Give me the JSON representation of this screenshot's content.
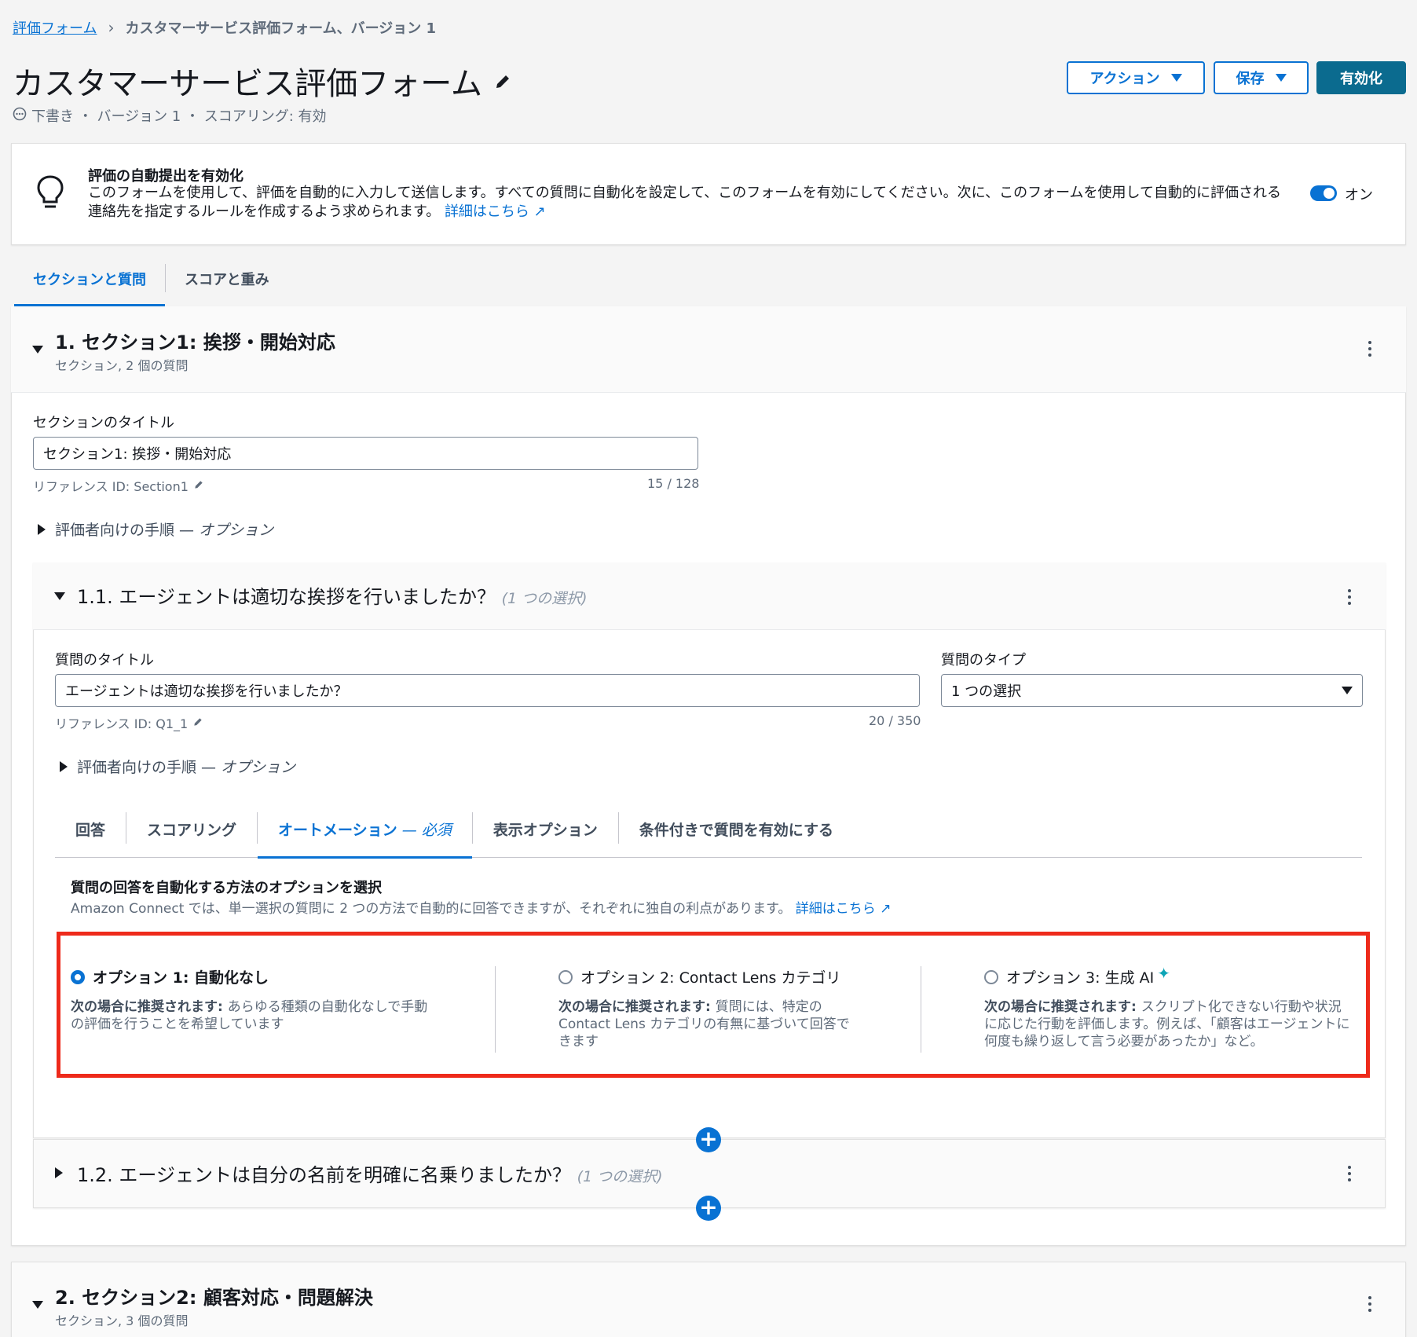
{
  "breadcrumb": {
    "root": "評価フォーム",
    "current": "カスタマーサービス評価フォーム、バージョン 1"
  },
  "header": {
    "title": "カスタマーサービス評価フォーム",
    "status": "下書き ・ バージョン 1 ・ スコアリング: 有効",
    "actions_label": "アクション",
    "save_label": "保存",
    "activate_label": "有効化"
  },
  "banner": {
    "title": "評価の自動提出を有効化",
    "text": "このフォームを使用して、評価を自動的に入力して送信します。すべての質問に自動化を設定して、このフォームを有効にしてください。次に、このフォームを使用して自動的に評価される連絡先を指定するルールを作成するよう求められます。",
    "link": "詳細はこちら",
    "toggle_label": "オン"
  },
  "tabs": [
    "セクションと質問",
    "スコアと重み"
  ],
  "section1": {
    "title": "1. セクション1: 挨拶・開始対応",
    "subtitle": "セクション, 2 個の質問",
    "field_label": "セクションのタイトル",
    "field_value": "セクション1: 挨拶・開始対応",
    "ref_id": "リファレンス ID: Section1",
    "char_count": "15 / 128",
    "instructions_label": "評価者向けの手順 — ",
    "instructions_optional": "オプション"
  },
  "question1": {
    "title": "1.1. エージェントは適切な挨拶を行いましたか？",
    "badge": "(1 つの選択)",
    "title_label": "質問のタイトル",
    "title_value": "エージェントは適切な挨拶を行いましたか？",
    "ref_id": "リファレンス ID: Q1_1",
    "char_count": "20 / 350",
    "type_label": "質問のタイプ",
    "type_value": "1 つの選択",
    "instructions_label": "評価者向けの手順 — ",
    "instructions_optional": "オプション",
    "tabs": {
      "answers": "回答",
      "scoring": "スコアリング",
      "automation": "オートメーション",
      "automation_required": " — 必須",
      "display": "表示オプション",
      "conditional": "条件付きで質問を有効にする"
    },
    "automation": {
      "heading": "質問の回答を自動化する方法のオプションを選択",
      "description": "Amazon Connect では、単一選択の質問に 2 つの方法で自動的に回答できますが、それぞれに独自の利点があります。",
      "link": "詳細はこちら",
      "options": [
        {
          "label": "オプション 1: 自動化なし",
          "lead": "次の場合に推奨されます: ",
          "desc": "あらゆる種類の自動化なしで手動の評価を行うことを希望しています",
          "selected": true
        },
        {
          "label": "オプション 2: Contact Lens カテゴリ",
          "lead": "次の場合に推奨されます: ",
          "desc": "質問には、特定の Contact Lens カテゴリの有無に基づいて回答できます",
          "selected": false
        },
        {
          "label": "オプション 3: 生成 AI",
          "lead": "次の場合に推奨されます: ",
          "desc": "スクリプト化できない行動や状況に応じた行動を評価します。例えば、「顧客はエージェントに何度も繰り返して言う必要があったか」など。",
          "selected": false
        }
      ]
    }
  },
  "question2": {
    "title": "1.2. エージェントは自分の名前を明確に名乗りましたか？",
    "badge": "(1 つの選択)"
  },
  "section2": {
    "title": "2. セクション2: 顧客対応・問題解決",
    "subtitle": "セクション, 3 個の質問"
  },
  "colors": {
    "accent": "#0972d3",
    "primary_button": "#0b6b8f",
    "highlight_border": "#ee2a1b"
  }
}
